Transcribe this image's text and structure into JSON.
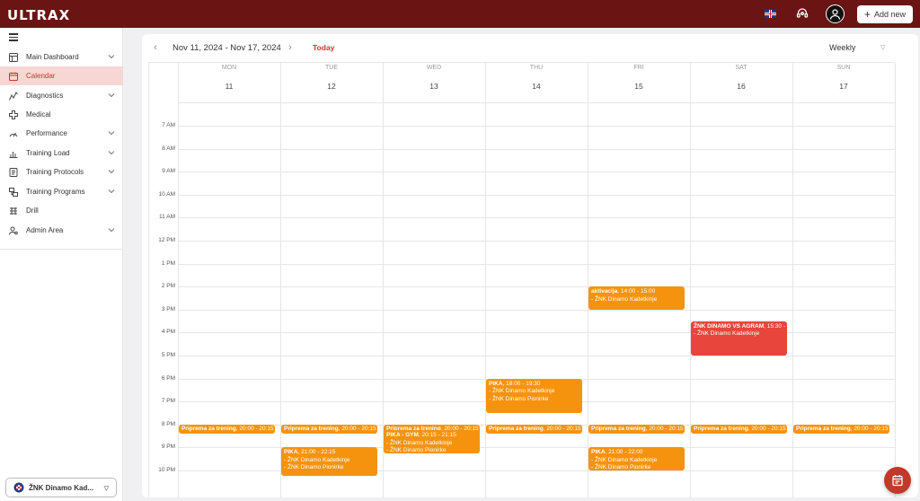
{
  "app": {
    "logo": "ULTRAX",
    "add_new": "Add new"
  },
  "sidebar": {
    "items": [
      {
        "label": "Main Dashboard",
        "icon": "dashboard-icon",
        "expandable": true
      },
      {
        "label": "Calendar",
        "icon": "calendar-icon",
        "active": true
      },
      {
        "label": "Diagnostics",
        "icon": "diagnostics-icon",
        "expandable": true
      },
      {
        "label": "Medical",
        "icon": "medical-icon"
      },
      {
        "label": "Performance",
        "icon": "performance-icon",
        "expandable": true
      },
      {
        "label": "Training Load",
        "icon": "training-load-icon",
        "expandable": true
      },
      {
        "label": "Training Protocols",
        "icon": "protocols-icon",
        "expandable": true
      },
      {
        "label": "Training Programs",
        "icon": "programs-icon",
        "expandable": true
      },
      {
        "label": "Drill",
        "icon": "drill-icon"
      },
      {
        "label": "Admin Area",
        "icon": "admin-icon",
        "expandable": true
      }
    ],
    "team": "ŽNK Dinamo Kad..."
  },
  "calendar": {
    "range": "Nov 11, 2024 - Nov 17, 2024",
    "today": "Today",
    "view": "Weekly",
    "days": [
      {
        "name": "MON",
        "num": "11"
      },
      {
        "name": "TUE",
        "num": "12"
      },
      {
        "name": "WED",
        "num": "13"
      },
      {
        "name": "THU",
        "num": "14"
      },
      {
        "name": "FRI",
        "num": "15"
      },
      {
        "name": "SAT",
        "num": "16"
      },
      {
        "name": "SUN",
        "num": "17"
      }
    ],
    "hours": [
      "7 AM",
      "8 AM",
      "9 AM",
      "10 AM",
      "11 AM",
      "12 PM",
      "1 PM",
      "2 PM",
      "3 PM",
      "4 PM",
      "5 PM",
      "6 PM",
      "7 PM",
      "8 PM",
      "9 PM",
      "10 PM"
    ],
    "events": [
      {
        "day": 4,
        "title": "aktivacija",
        "time": "14:00 - 15:00",
        "lines": [
          "- ŽNK Dinamo Kadetkinje"
        ],
        "color": "#f5930f",
        "start": 14.0,
        "end": 15.0
      },
      {
        "day": 5,
        "title": "ŽNK DINAMO VS AGRAM",
        "time": "15:30 -",
        "lines": [
          "- ŽNK Dinamo Kadetkinje"
        ],
        "color": "#e8453c",
        "start": 15.5,
        "end": 17.0
      },
      {
        "day": 3,
        "title": "PIKA",
        "time": "18:00 - 19:30",
        "lines": [
          "- ŽNK Dinamo Kadetkinje",
          "- ŽNK Dinamo Pionirke"
        ],
        "color": "#f5930f",
        "start": 18.0,
        "end": 19.5
      },
      {
        "day": 0,
        "title": "Priprema za trening",
        "time": "20:00 - 20:15",
        "lines": [],
        "color": "#f5930f",
        "start": 20.0,
        "end": 20.4
      },
      {
        "day": 1,
        "title": "Priprema za trening",
        "time": "20:00 - 20:15",
        "lines": [],
        "color": "#f5930f",
        "start": 20.0,
        "end": 20.4
      },
      {
        "day": 2,
        "title": "Priprema za trening",
        "time": "20:00 - 20:15",
        "lines": [],
        "color": "#f5930f",
        "start": 20.0,
        "end": 20.4
      },
      {
        "day": 3,
        "title": "Priprema za trening",
        "time": "20:00 - 20:15",
        "lines": [],
        "color": "#f5930f",
        "start": 20.0,
        "end": 20.4
      },
      {
        "day": 4,
        "title": "Priprema za trening",
        "time": "20:00 - 20:15",
        "lines": [],
        "color": "#f5930f",
        "start": 20.0,
        "end": 20.4
      },
      {
        "day": 5,
        "title": "Priprema za trening",
        "time": "20:00 - 20:15",
        "lines": [],
        "color": "#f5930f",
        "start": 20.0,
        "end": 20.4
      },
      {
        "day": 6,
        "title": "Priprema za trening",
        "time": "20:00 - 20:15",
        "lines": [],
        "color": "#f5930f",
        "start": 20.0,
        "end": 20.4
      },
      {
        "day": 2,
        "title": "PIKA - GYM",
        "time": "20:15 - 21:15",
        "lines": [
          "- ŽNK Dinamo Kadetkinje",
          "- ŽNK Dinamo Pionirke"
        ],
        "color": "#f5930f",
        "start": 20.25,
        "end": 21.25
      },
      {
        "day": 1,
        "title": "PIKA",
        "time": "21:00 - 22:15",
        "lines": [
          "- ŽNK Dinamo Kadetkinje",
          "- ŽNK Dinamo Pionirke"
        ],
        "color": "#f5930f",
        "start": 21.0,
        "end": 22.25
      },
      {
        "day": 4,
        "title": "PIKA",
        "time": "21:00 - 22:00",
        "lines": [
          "- ŽNK Dinamo Kadetkinje",
          "- ŽNK Dinamo Pionirke"
        ],
        "color": "#f5930f",
        "start": 21.0,
        "end": 22.0
      }
    ]
  }
}
